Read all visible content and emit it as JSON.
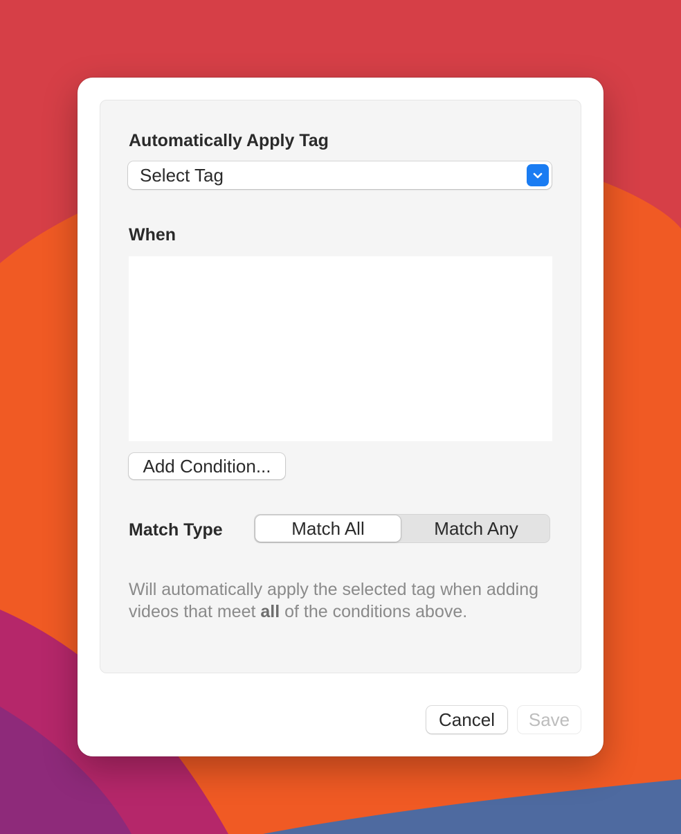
{
  "dialog": {
    "tag_section": {
      "label": "Automatically Apply Tag",
      "select_value": "Select Tag"
    },
    "when_section": {
      "label": "When",
      "conditions": [],
      "add_button_label": "Add Condition..."
    },
    "match_type": {
      "label": "Match Type",
      "options": [
        "Match All",
        "Match Any"
      ],
      "selected": "Match All"
    },
    "description": {
      "before": "Will automatically apply the selected tag when adding videos that meet ",
      "emphasis": "all",
      "after": " of the conditions above."
    },
    "footer": {
      "cancel_label": "Cancel",
      "save_label": "Save",
      "save_enabled": false
    }
  },
  "colors": {
    "accent": "#1a7cf2",
    "wallpaper_red": "#d63f47",
    "wallpaper_orange": "#f05a24",
    "wallpaper_magenta": "#b5276a",
    "wallpaper_blue": "#4e6aa0"
  }
}
